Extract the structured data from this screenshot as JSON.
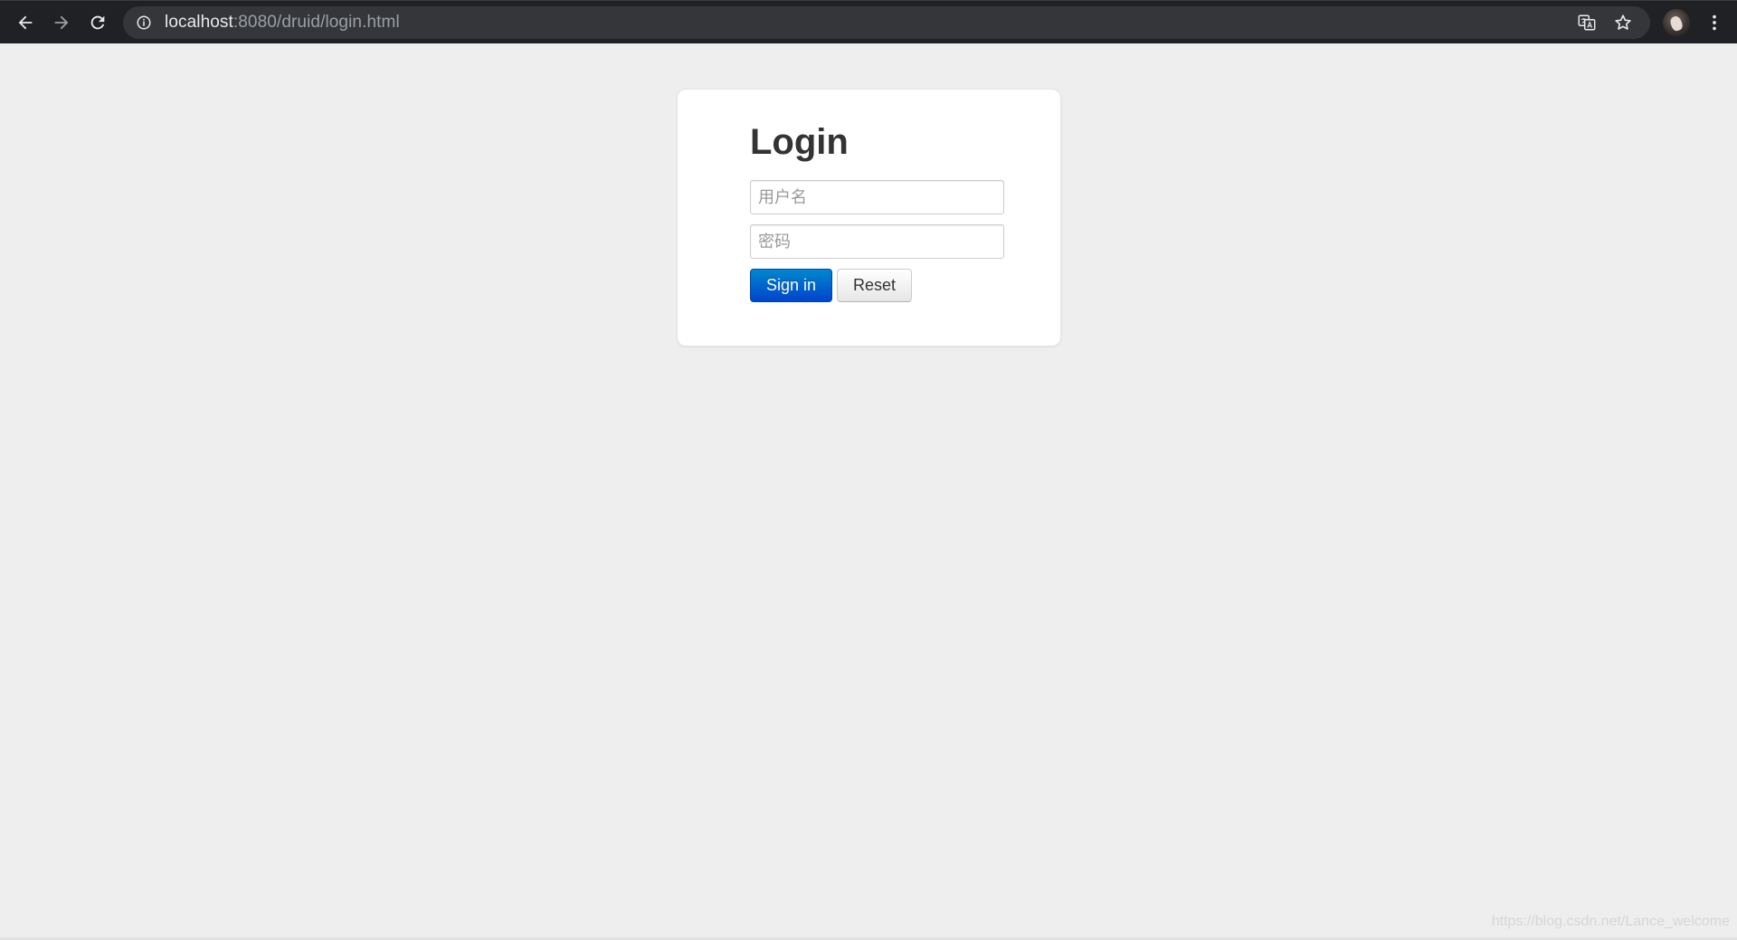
{
  "browser": {
    "url_host": "localhost",
    "url_rest": ":8080/druid/login.html"
  },
  "login": {
    "title": "Login",
    "username_placeholder": "用户名",
    "password_placeholder": "密码",
    "signin_label": "Sign in",
    "reset_label": "Reset"
  },
  "colors": {
    "signin_button": "#0055cc",
    "page_background": "#eeeeee",
    "toolbar_background": "#202124"
  },
  "icons": {
    "back": "back-arrow-icon",
    "forward": "forward-arrow-icon",
    "reload": "reload-icon",
    "site_info": "info-icon",
    "translate": "translate-icon",
    "bookmark": "star-icon",
    "menu": "kebab-menu-icon"
  },
  "watermark": "https://blog.csdn.net/Lance_welcome"
}
